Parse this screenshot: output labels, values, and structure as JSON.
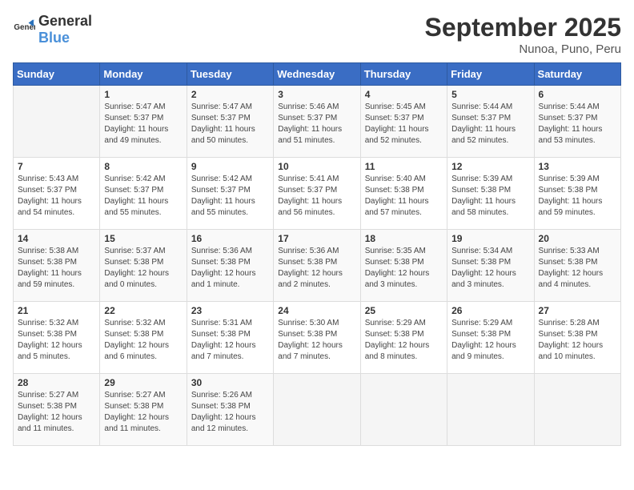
{
  "logo": {
    "general": "General",
    "blue": "Blue"
  },
  "title": "September 2025",
  "subtitle": "Nunoa, Puno, Peru",
  "days_of_week": [
    "Sunday",
    "Monday",
    "Tuesday",
    "Wednesday",
    "Thursday",
    "Friday",
    "Saturday"
  ],
  "weeks": [
    [
      {
        "day": "",
        "info": ""
      },
      {
        "day": "1",
        "info": "Sunrise: 5:47 AM\nSunset: 5:37 PM\nDaylight: 11 hours\nand 49 minutes."
      },
      {
        "day": "2",
        "info": "Sunrise: 5:47 AM\nSunset: 5:37 PM\nDaylight: 11 hours\nand 50 minutes."
      },
      {
        "day": "3",
        "info": "Sunrise: 5:46 AM\nSunset: 5:37 PM\nDaylight: 11 hours\nand 51 minutes."
      },
      {
        "day": "4",
        "info": "Sunrise: 5:45 AM\nSunset: 5:37 PM\nDaylight: 11 hours\nand 52 minutes."
      },
      {
        "day": "5",
        "info": "Sunrise: 5:44 AM\nSunset: 5:37 PM\nDaylight: 11 hours\nand 52 minutes."
      },
      {
        "day": "6",
        "info": "Sunrise: 5:44 AM\nSunset: 5:37 PM\nDaylight: 11 hours\nand 53 minutes."
      }
    ],
    [
      {
        "day": "7",
        "info": "Sunrise: 5:43 AM\nSunset: 5:37 PM\nDaylight: 11 hours\nand 54 minutes."
      },
      {
        "day": "8",
        "info": "Sunrise: 5:42 AM\nSunset: 5:37 PM\nDaylight: 11 hours\nand 55 minutes."
      },
      {
        "day": "9",
        "info": "Sunrise: 5:42 AM\nSunset: 5:37 PM\nDaylight: 11 hours\nand 55 minutes."
      },
      {
        "day": "10",
        "info": "Sunrise: 5:41 AM\nSunset: 5:37 PM\nDaylight: 11 hours\nand 56 minutes."
      },
      {
        "day": "11",
        "info": "Sunrise: 5:40 AM\nSunset: 5:38 PM\nDaylight: 11 hours\nand 57 minutes."
      },
      {
        "day": "12",
        "info": "Sunrise: 5:39 AM\nSunset: 5:38 PM\nDaylight: 11 hours\nand 58 minutes."
      },
      {
        "day": "13",
        "info": "Sunrise: 5:39 AM\nSunset: 5:38 PM\nDaylight: 11 hours\nand 59 minutes."
      }
    ],
    [
      {
        "day": "14",
        "info": "Sunrise: 5:38 AM\nSunset: 5:38 PM\nDaylight: 11 hours\nand 59 minutes."
      },
      {
        "day": "15",
        "info": "Sunrise: 5:37 AM\nSunset: 5:38 PM\nDaylight: 12 hours\nand 0 minutes."
      },
      {
        "day": "16",
        "info": "Sunrise: 5:36 AM\nSunset: 5:38 PM\nDaylight: 12 hours\nand 1 minute."
      },
      {
        "day": "17",
        "info": "Sunrise: 5:36 AM\nSunset: 5:38 PM\nDaylight: 12 hours\nand 2 minutes."
      },
      {
        "day": "18",
        "info": "Sunrise: 5:35 AM\nSunset: 5:38 PM\nDaylight: 12 hours\nand 3 minutes."
      },
      {
        "day": "19",
        "info": "Sunrise: 5:34 AM\nSunset: 5:38 PM\nDaylight: 12 hours\nand 3 minutes."
      },
      {
        "day": "20",
        "info": "Sunrise: 5:33 AM\nSunset: 5:38 PM\nDaylight: 12 hours\nand 4 minutes."
      }
    ],
    [
      {
        "day": "21",
        "info": "Sunrise: 5:32 AM\nSunset: 5:38 PM\nDaylight: 12 hours\nand 5 minutes."
      },
      {
        "day": "22",
        "info": "Sunrise: 5:32 AM\nSunset: 5:38 PM\nDaylight: 12 hours\nand 6 minutes."
      },
      {
        "day": "23",
        "info": "Sunrise: 5:31 AM\nSunset: 5:38 PM\nDaylight: 12 hours\nand 7 minutes."
      },
      {
        "day": "24",
        "info": "Sunrise: 5:30 AM\nSunset: 5:38 PM\nDaylight: 12 hours\nand 7 minutes."
      },
      {
        "day": "25",
        "info": "Sunrise: 5:29 AM\nSunset: 5:38 PM\nDaylight: 12 hours\nand 8 minutes."
      },
      {
        "day": "26",
        "info": "Sunrise: 5:29 AM\nSunset: 5:38 PM\nDaylight: 12 hours\nand 9 minutes."
      },
      {
        "day": "27",
        "info": "Sunrise: 5:28 AM\nSunset: 5:38 PM\nDaylight: 12 hours\nand 10 minutes."
      }
    ],
    [
      {
        "day": "28",
        "info": "Sunrise: 5:27 AM\nSunset: 5:38 PM\nDaylight: 12 hours\nand 11 minutes."
      },
      {
        "day": "29",
        "info": "Sunrise: 5:27 AM\nSunset: 5:38 PM\nDaylight: 12 hours\nand 11 minutes."
      },
      {
        "day": "30",
        "info": "Sunrise: 5:26 AM\nSunset: 5:38 PM\nDaylight: 12 hours\nand 12 minutes."
      },
      {
        "day": "",
        "info": ""
      },
      {
        "day": "",
        "info": ""
      },
      {
        "day": "",
        "info": ""
      },
      {
        "day": "",
        "info": ""
      }
    ]
  ]
}
